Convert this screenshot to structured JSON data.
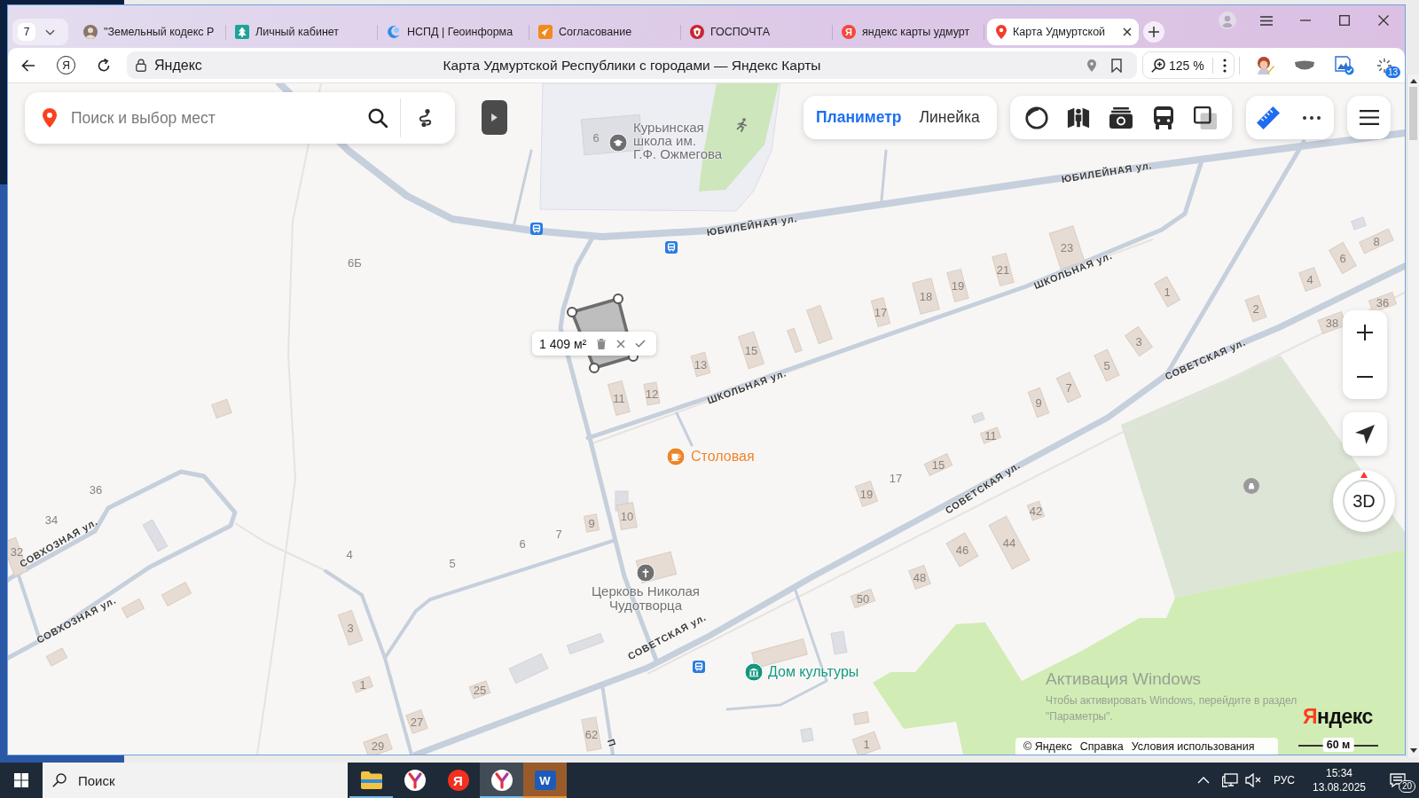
{
  "browser": {
    "tab_count": "7",
    "tabs": [
      {
        "title": "\"Земельный кодекс Р",
        "kind": "avatar",
        "selected": false
      },
      {
        "title": "Личный кабинет",
        "kind": "emblem",
        "selected": false
      },
      {
        "title": "НСПД | Геоинформа",
        "kind": "crescent",
        "selected": false
      },
      {
        "title": "Согласование",
        "kind": "tile",
        "selected": false
      },
      {
        "title": "ГОСПОЧТА",
        "kind": "crest",
        "selected": false
      },
      {
        "title": "яндекс карты удмурт",
        "kind": "letter",
        "letter": "Я",
        "selected": false
      },
      {
        "title": "Карта Удмуртской",
        "kind": "pin",
        "selected": true
      }
    ],
    "home_letter": "Я",
    "site": "Яндекс",
    "page_title": "Карта Удмуртской Республики с городами — Яндекс Карты",
    "zoom": "125 %",
    "extension_badge": "13"
  },
  "map": {
    "search": {
      "placeholder": "Поиск и выбор мест"
    },
    "measure_tabs": [
      {
        "label": "Планиметр",
        "selected": true
      },
      {
        "label": "Линейка",
        "selected": false
      }
    ],
    "ruler_active": true,
    "compass": "3D",
    "area": "1 409 м²",
    "streets": [
      "ЮБИЛЕЙНАЯ ул.",
      "ЮБИЛЕЙНАЯ ул.",
      "ШКОЛЬНАЯ ул.",
      "ШКОЛЬНАЯ ул.",
      "СОВЕТСКАЯ ул.",
      "СОВЕТСКАЯ ул.",
      "СОВЕТСКАЯ ул.",
      "СОВХОЗНАЯ ул.",
      "СОВХОЗНАЯ ул.",
      "П"
    ],
    "house_numbers": [
      "6",
      "6Б",
      "23",
      "21",
      "19",
      "18",
      "17",
      "15",
      "13",
      "12",
      "11",
      "8",
      "6",
      "4",
      "36",
      "38",
      "2",
      "1",
      "3",
      "5",
      "7",
      "9",
      "11",
      "15",
      "17",
      "19",
      "42",
      "44",
      "46",
      "48",
      "50",
      "10",
      "9",
      "7",
      "6",
      "5",
      "4",
      "36",
      "34",
      "32",
      "3",
      "1",
      "25",
      "27",
      "29",
      "62",
      "1"
    ],
    "places": [
      {
        "kind": "school",
        "name": "Курьинская школа им. Г.Ф. Ожмегова",
        "color": "#6f6f73"
      },
      {
        "kind": "cafe",
        "name": "Столовая",
        "color": "#ee8428"
      },
      {
        "kind": "church",
        "name": "Церковь Николая Чудотворца",
        "color": "#707070"
      },
      {
        "kind": "culture",
        "name": "Дом культуры",
        "color": "#13977e"
      }
    ],
    "logo": "Яндекс",
    "footer_links": [
      "© Яндекс",
      "Справка",
      "Условия использования"
    ],
    "scale": "60 м"
  },
  "activation": {
    "title": "Активация Windows",
    "text": "Чтобы активировать Windows, перейдите в раздел \"Параметры\"."
  },
  "taskbar": {
    "search_placeholder": "Поиск",
    "apps": [
      {
        "kind": "folder",
        "selected": false,
        "running": true,
        "attention": false
      },
      {
        "kind": "browser",
        "selected": false,
        "running": false,
        "attention": false
      },
      {
        "kind": "letter",
        "letter": "Я",
        "selected": false,
        "running": false,
        "attention": false
      },
      {
        "kind": "browser",
        "selected": true,
        "running": true,
        "attention": false
      },
      {
        "kind": "word",
        "letter": "W",
        "selected": false,
        "running": true,
        "attention": true
      }
    ],
    "language": "РУС",
    "time": "15:34",
    "date": "13.08.2025",
    "notifications": "20"
  }
}
